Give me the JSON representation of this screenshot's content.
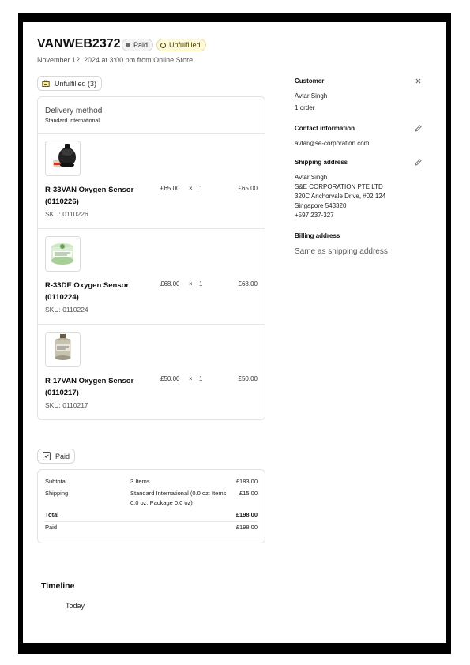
{
  "order": {
    "id": "VANWEB2372",
    "paid_badge": "Paid",
    "fulfillment_badge": "Unfulfilled",
    "subline": "November 12, 2024 at 3:00 pm from Online Store"
  },
  "fulfillment": {
    "status_label": "Unfulfilled (3)",
    "delivery_method_title": "Delivery method",
    "delivery_method_value": "Standard International",
    "items": [
      {
        "name": "R-33VAN Oxygen Sensor (0110226)",
        "sku": "SKU: 0110226",
        "price": "£65.00",
        "times": "×",
        "qty": "1",
        "total": "£65.00",
        "thumb_icon": "black-sensor-image"
      },
      {
        "name": "R-33DE Oxygen Sensor (0110224)",
        "sku": "SKU: 0110224",
        "price": "£68.00",
        "times": "×",
        "qty": "1",
        "total": "£68.00",
        "thumb_icon": "green-sensor-image"
      },
      {
        "name": "R-17VAN Oxygen Sensor (0110217)",
        "sku": "SKU: 0110217",
        "price": "£50.00",
        "times": "×",
        "qty": "1",
        "total": "£50.00",
        "thumb_icon": "grey-sensor-image"
      }
    ]
  },
  "payment": {
    "status_label": "Paid",
    "subtotal_label": "Subtotal",
    "subtotal_detail": "3 Items",
    "subtotal_value": "£183.00",
    "shipping_label": "Shipping",
    "shipping_detail": "Standard International (0.0 oz: Items 0.0 oz, Package 0.0 oz)",
    "shipping_value": "£15.00",
    "total_label": "Total",
    "total_value": "£198.00",
    "paid_label": "Paid",
    "paid_value": "£198.00"
  },
  "timeline": {
    "title": "Timeline",
    "today": "Today"
  },
  "customer": {
    "title": "Customer",
    "name": "Avtar Singh",
    "orders": "1 order",
    "contact_title": "Contact information",
    "email": "avtar@se-corporation.com",
    "shipping_title": "Shipping address",
    "shipping_lines": [
      "Avtar Singh",
      "S&E CORPORATION PTE LTD",
      "320C Anchorvale Drive, #02 124",
      "Singapore 543320",
      "+597 237-327"
    ],
    "billing_title": "Billing address",
    "billing_value": "Same as shipping address"
  },
  "icons": {
    "close": "close-icon",
    "edit": "pencil-icon",
    "package": "package-icon",
    "receipt": "receipt-icon"
  },
  "colors": {
    "unfulfilled_badge_bg": "#fdf9d9",
    "paid_badge_bg": "#f3f3f3"
  }
}
